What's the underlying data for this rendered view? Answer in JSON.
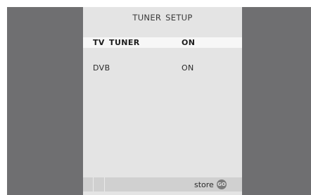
{
  "menu": {
    "title": "TUNER SETUP",
    "rows": [
      {
        "label": "TV TUNER",
        "value": "ON",
        "selected": true
      },
      {
        "label": "DVB",
        "value": "ON",
        "selected": false
      }
    ]
  },
  "footer": {
    "store_label": "store",
    "go_button_label": "GO"
  },
  "colors": {
    "background": "#6f6f71",
    "panel": "#e4e4e4",
    "selected_row": "#f7f7f7",
    "bottom_bar": "#d0d0d0"
  }
}
